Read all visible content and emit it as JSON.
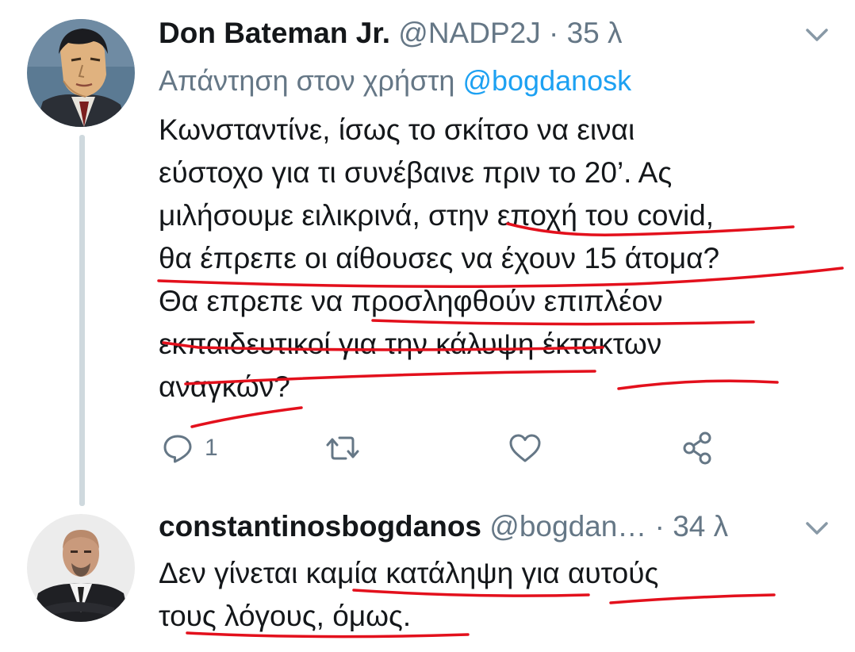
{
  "tweet1": {
    "display_name": "Don Bateman Jr.",
    "handle": "@NADP2J",
    "separator": "·",
    "time": "35 λ",
    "reply_prefix": "Απάντηση στον χρήστη",
    "reply_handle": "@bogdanosk",
    "text_lines": [
      "Κωνσταντίνε, ίσως το σκίτσο να ειναι",
      "εύστοχο για τι συνέβαινε πριν το 20’. Ας",
      "μιλήσουμε ειλικρινά, στην εποχή του covid,",
      "θα έπρεπε οι αίθουσες να έχουν 15 άτομα?",
      "Θα επρεπε να προσληφθούν επιπλέον",
      "εκπαιδευτικοί για την κάλυψη έκτακτων",
      "αναγκών?"
    ],
    "reply_count": "1",
    "icons": {
      "reply": "reply-icon",
      "retweet": "retweet-icon",
      "like": "heart-icon",
      "share": "share-icon",
      "menu": "chevron-down-icon"
    }
  },
  "tweet2": {
    "display_name": "constantinosbogdanos",
    "handle": "@bogdan…",
    "separator": "·",
    "time": "34 λ",
    "text_lines": [
      "Δεν γίνεται καμία κατάληψη για αυτούς",
      "τους λόγους, όμως."
    ],
    "icons": {
      "menu": "chevron-down-icon"
    }
  },
  "colors": {
    "text": "#14171a",
    "secondary": "#657786",
    "link": "#1da1f2",
    "thread_line": "#cfd9de",
    "annotation": "#e3101c"
  }
}
